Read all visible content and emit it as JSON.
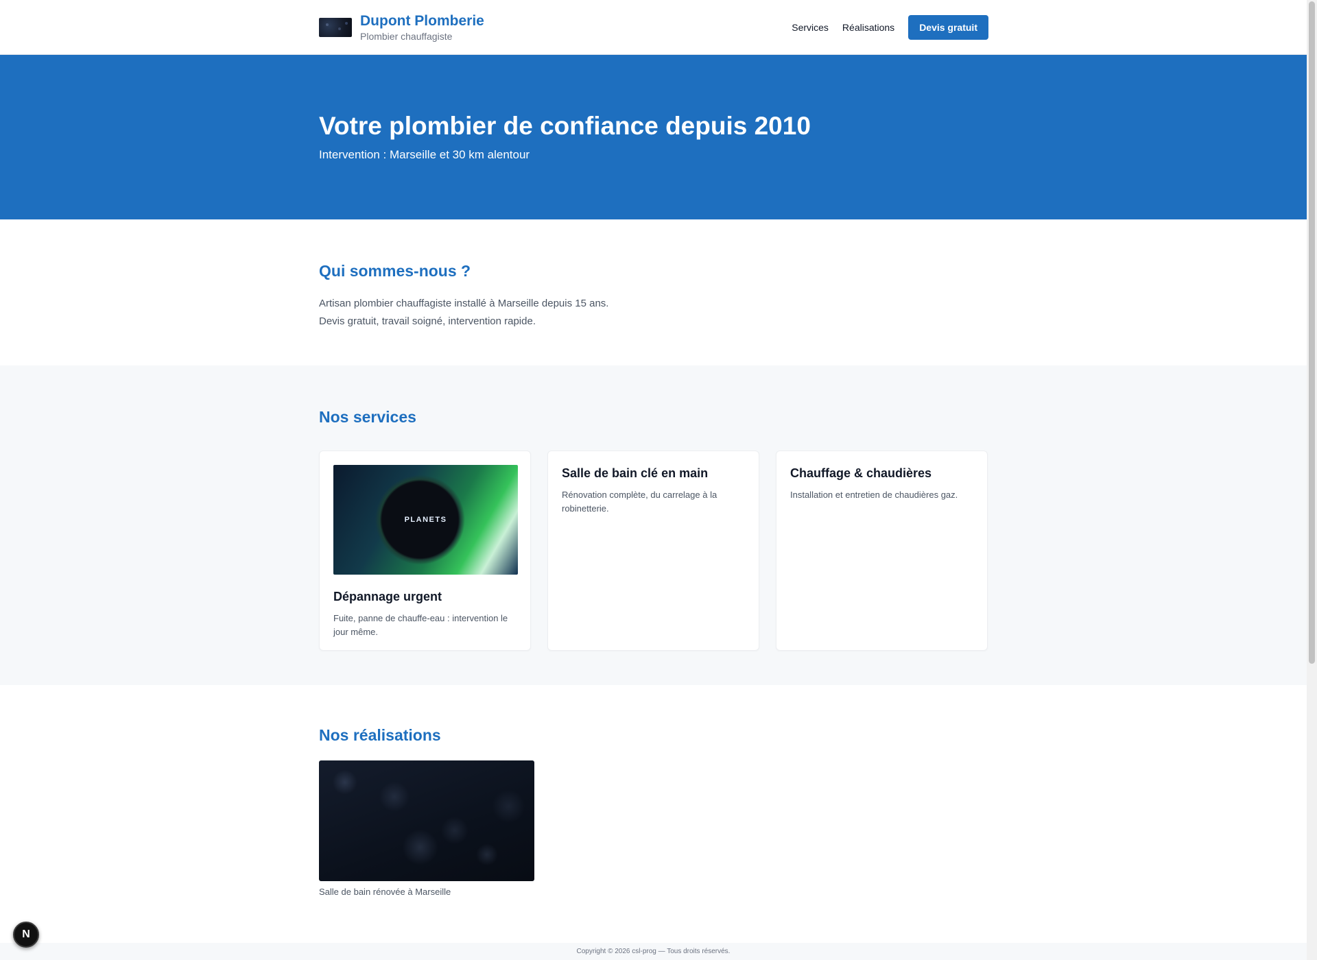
{
  "header": {
    "brand_name": "Dupont Plomberie",
    "brand_tagline": "Plombier chauffagiste",
    "nav": {
      "services": "Services",
      "realisations": "Réalisations",
      "quote_button": "Devis gratuit"
    }
  },
  "hero": {
    "title": "Votre plombier de confiance depuis 2010",
    "subtitle": "Intervention : Marseille et 30 km alentour"
  },
  "about": {
    "title": "Qui sommes-nous ?",
    "line1": "Artisan plombier chauffagiste installé à Marseille depuis 15 ans.",
    "line2": "Devis gratuit, travail soigné, intervention rapide."
  },
  "services": {
    "title": "Nos services",
    "items": [
      {
        "title": "Dépannage urgent",
        "description": "Fuite, panne de chauffe-eau : intervention le jour même.",
        "image_label": "PLANETS"
      },
      {
        "title": "Salle de bain clé en main",
        "description": "Rénovation complète, du carrelage à la robinetterie."
      },
      {
        "title": "Chauffage & chaudières",
        "description": "Installation et entretien de chaudières gaz."
      }
    ]
  },
  "realisations": {
    "title": "Nos réalisations",
    "items": [
      {
        "caption": "Salle de bain rénovée à Marseille"
      }
    ]
  },
  "footer": {
    "copyright": "Copyright © 2026 csl-prog — Tous droits réservés."
  },
  "floating_badge": {
    "label": "N"
  },
  "colors": {
    "accent": "#1e6fbf",
    "section_alt_bg": "#f6f8fa"
  }
}
